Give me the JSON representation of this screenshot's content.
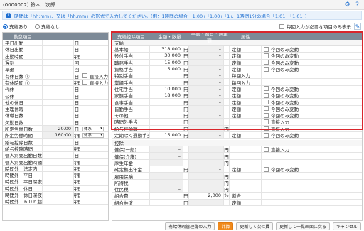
{
  "window": {
    "title": "(0000002) 鈴木　次郎"
  },
  "notice": {
    "text": "時間は「hh:mm」、又は「hh.mm」の形式で入力してください。(例：1時間の場合「1:00」「1.00」「1」、1時間1分の場合「1:01」「1.01」)"
  },
  "options": {
    "pay_yes": "支給あり",
    "pay_no": "支給なし",
    "input_required_only": "毎回入力が必要な項目のみ表示"
  },
  "attendance": {
    "header": "勤怠項目",
    "rows": [
      {
        "label": "平日出勤",
        "value": "",
        "unit": "日",
        "extra": ""
      },
      {
        "label": "休日出勤",
        "value": "",
        "unit": "日",
        "extra": ""
      },
      {
        "label": "出勤時間",
        "value": "",
        "unit": "時間",
        "extra": ""
      },
      {
        "label": "遅刻",
        "value": "",
        "unit": "回",
        "extra": ""
      },
      {
        "label": "早退",
        "value": "",
        "unit": "回",
        "extra": ""
      },
      {
        "label": "有休日数 ⓘ",
        "value": "",
        "unit": "日",
        "extra": "直接入力"
      },
      {
        "label": "有休時間 ⓘ",
        "value": "",
        "unit": "時間",
        "extra": "直接入力"
      },
      {
        "label": "代休",
        "value": "",
        "unit": "日",
        "extra": ""
      },
      {
        "label": "公休",
        "value": "",
        "unit": "日",
        "extra": ""
      },
      {
        "label": "他の休日",
        "value": "",
        "unit": "日",
        "extra": ""
      },
      {
        "label": "生理休暇",
        "value": "",
        "unit": "日",
        "extra": ""
      },
      {
        "label": "休職日数",
        "value": "",
        "unit": "日",
        "extra": ""
      },
      {
        "label": "欠勤日数",
        "value": "",
        "unit": "日",
        "extra": ""
      },
      {
        "label": "所定労働日数",
        "value": "20.00",
        "unit": "日",
        "extra": "体系"
      },
      {
        "label": "所定労働時間",
        "value": "160:00",
        "unit": "時間",
        "extra": "体系"
      },
      {
        "label": "給与控除日数",
        "value": "",
        "unit": "日",
        "extra": ""
      },
      {
        "label": "給与控除時間",
        "value": "",
        "unit": "時間",
        "extra": ""
      },
      {
        "label": "個人別要出勤日数",
        "value": "",
        "unit": "日",
        "extra": ""
      },
      {
        "label": "個人別要出勤時間",
        "value": "",
        "unit": "時間",
        "extra": ""
      },
      {
        "label": "時間外　法定内",
        "value": "",
        "unit": "時間",
        "extra": ""
      },
      {
        "label": "時間外　平日",
        "value": "",
        "unit": "時間",
        "extra": ""
      },
      {
        "label": "時間外　平日深夜",
        "value": "",
        "unit": "時間",
        "extra": ""
      },
      {
        "label": "時間外　休日",
        "value": "",
        "unit": "時間",
        "extra": ""
      },
      {
        "label": "時間外　休日深夜",
        "value": "",
        "unit": "時間",
        "extra": ""
      },
      {
        "label": "時間外　６０ｈ超",
        "value": "",
        "unit": "時間",
        "extra": ""
      }
    ]
  },
  "paydeduct": {
    "headers": [
      "支給控除項目",
      "金額・数量",
      "単価・割合・調整額",
      "属性",
      ""
    ],
    "section_pay": "支給",
    "pay_rows": [
      {
        "label": "基本給",
        "amount": "318,000",
        "u1": "円",
        "rate": "–",
        "u2": "",
        "attr": "定額",
        "opt": "今回のみ変動"
      },
      {
        "label": "役付手当",
        "amount": "30,000",
        "u1": "円",
        "rate": "–",
        "u2": "",
        "attr": "定額",
        "opt": "今回のみ変動"
      },
      {
        "label": "職務手当",
        "amount": "15,000",
        "u1": "円",
        "rate": "–",
        "u2": "",
        "attr": "定額",
        "opt": "今回のみ変動"
      },
      {
        "label": "資格手当",
        "amount": "5,000",
        "u1": "円",
        "rate": "–",
        "u2": "",
        "attr": "定額",
        "opt": "今回のみ変動"
      },
      {
        "label": "特別手当",
        "amount": "",
        "u1": "円",
        "rate": "–",
        "u2": "",
        "attr": "毎回入力",
        "opt": ""
      },
      {
        "label": "業績手当",
        "amount": "",
        "u1": "円",
        "rate": "–",
        "u2": "",
        "attr": "毎回入力",
        "opt": ""
      },
      {
        "label": "住宅手当",
        "amount": "10,000",
        "u1": "円",
        "rate": "–",
        "u2": "",
        "attr": "定額",
        "opt": "今回のみ変動"
      },
      {
        "label": "家族手当",
        "amount": "18,000",
        "u1": "円",
        "rate": "–",
        "u2": "",
        "attr": "定額",
        "opt": "今回のみ変動"
      },
      {
        "label": "食事手当",
        "amount": "",
        "u1": "円",
        "rate": "–",
        "u2": "",
        "attr": "定額",
        "opt": "今回のみ変動"
      },
      {
        "label": "皆勤手当",
        "amount": "",
        "u1": "円",
        "rate": "–",
        "u2": "",
        "attr": "定額",
        "opt": "今回のみ変動"
      },
      {
        "label": "その他",
        "amount": "",
        "u1": "円",
        "rate": "–",
        "u2": "",
        "attr": "定額",
        "opt": "今回のみ変動"
      },
      {
        "label": "時間外手当",
        "amount": "",
        "u1": "円",
        "rate": "",
        "u2": "",
        "attr": "",
        "opt": "直接入力"
      },
      {
        "label": "給与控除額",
        "amount": "",
        "u1": "円",
        "rate": "",
        "u2": "円",
        "attr": "",
        "opt": "直接入力"
      },
      {
        "label": "定期除く通勤手当",
        "amount": "15,000",
        "u1": "円",
        "rate": "–",
        "u2": "",
        "attr": "定額",
        "opt": "今回のみ変動"
      }
    ],
    "section_deduct": "控除",
    "deduct_rows": [
      {
        "label": "健保(一般)",
        "amount": "–",
        "u1": "",
        "rate": "",
        "u2": "円",
        "attr": "",
        "opt": "直接入力"
      },
      {
        "label": "健保(介護)",
        "amount": "–",
        "u1": "",
        "rate": "",
        "u2": "円",
        "attr": "",
        "opt": ""
      },
      {
        "label": "厚生年金",
        "amount": "–",
        "u1": "",
        "rate": "",
        "u2": "円",
        "attr": "",
        "opt": ""
      },
      {
        "label": "確定拠出年金",
        "amount": "",
        "u1": "円",
        "rate": "–",
        "u2": "",
        "attr": "定額",
        "opt": "今回のみ変動"
      },
      {
        "label": "雇用保険",
        "amount": "–",
        "u1": "",
        "rate": "",
        "u2": "円",
        "attr": "",
        "opt": ""
      },
      {
        "label": "所得税",
        "amount": "–",
        "u1": "",
        "rate": "",
        "u2": "円",
        "attr": "",
        "opt": ""
      },
      {
        "label": "住民税",
        "amount": "–",
        "u1": "",
        "rate": "",
        "u2": "円",
        "attr": "",
        "opt": ""
      },
      {
        "label": "組合費",
        "amount": "",
        "u1": "円",
        "rate": "2,000",
        "u2": "%",
        "attr": "割合",
        "opt": ""
      },
      {
        "label": "組合共済",
        "amount": "",
        "u1": "円",
        "rate": "–",
        "u2": "",
        "attr": "定額",
        "opt": ""
      }
    ]
  },
  "footer": {
    "paid_leave": "有給休暇管理簿の入力",
    "calc": "計算",
    "update_next": "更新して次社員",
    "update_back": "更新して一覧画面に戻る",
    "cancel": "キャンセル"
  },
  "icons": {
    "settings": "gear-icon",
    "help": "help-icon",
    "info": "info-icon",
    "edit": "edit-icon"
  },
  "colors": {
    "accent": "#1e6fd1",
    "header": "#7d8a97",
    "highlight": "#d9262c",
    "primary_button": "#f08a1c"
  }
}
